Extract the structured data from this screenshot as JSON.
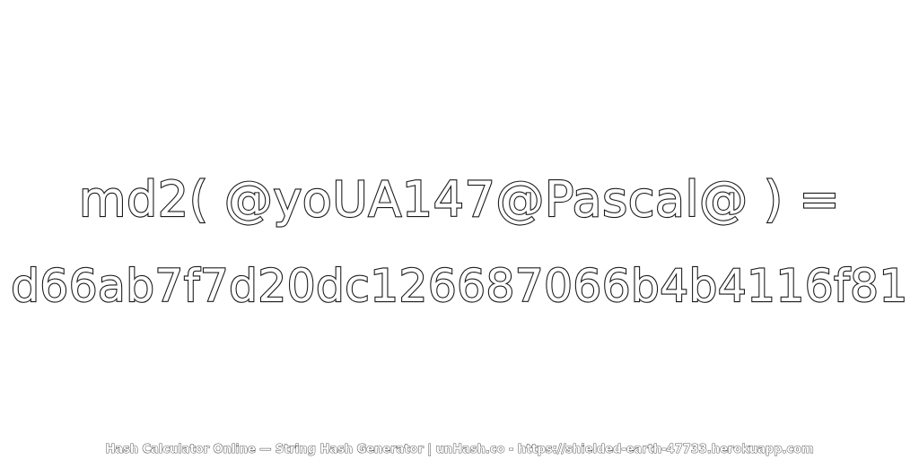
{
  "expression": "md2( @yoUA147@Pascal@ ) =",
  "hash_value": "d66ab7f7d20dc126687066b4b4116f81",
  "footer": "Hash Calculator Online — String Hash Generator | unHash.co - https://shielded-earth-47733.herokuapp.com",
  "colors": {
    "background": "#ffffff",
    "outline": "#1a1a1a",
    "fill": "#ffffff"
  }
}
